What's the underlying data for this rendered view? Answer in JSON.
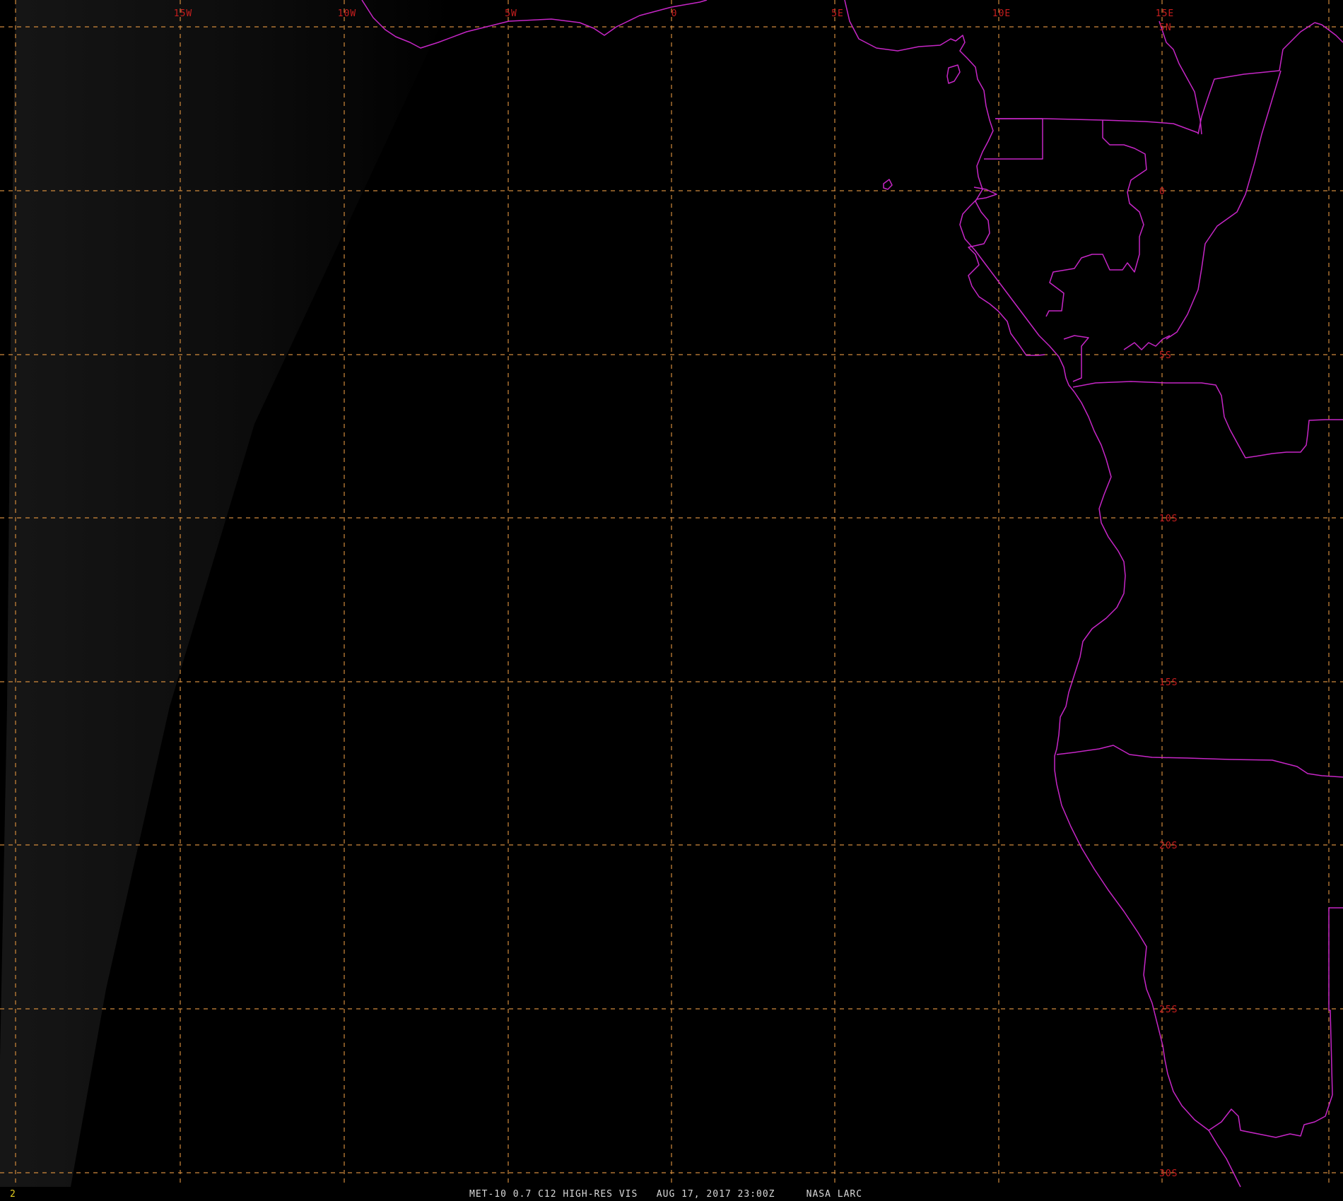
{
  "colors": {
    "background": "#000000",
    "terminator_glow": "#161616",
    "grid": "#d08a3c",
    "grid_label": "#c81e1e",
    "coastline": "#c626c6",
    "caption": "#d8d8d8",
    "frame_number": "#e6d020"
  },
  "map": {
    "lon_labels": [
      "15W",
      "10W",
      "5W",
      "0",
      "5E",
      "10E",
      "15E"
    ],
    "lat_labels": [
      "5N",
      "0",
      "5S",
      "10S",
      "15S",
      "20S",
      "25S",
      "30S"
    ]
  },
  "status": {
    "frame_number": "2",
    "caption": "MET-10 0.7 C12 HIGH-RES VIS   AUG 17, 2017 23:00Z     NASA LARC"
  }
}
